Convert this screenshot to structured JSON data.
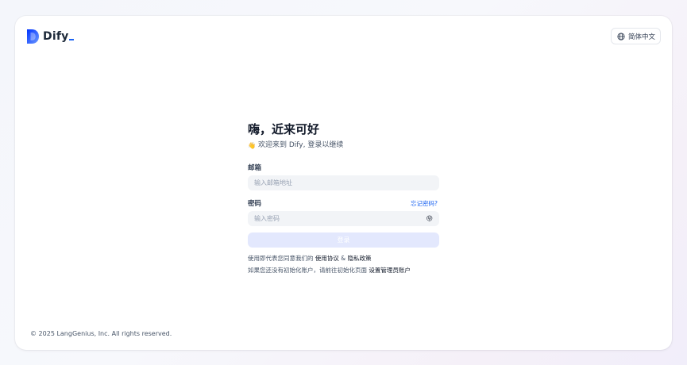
{
  "brand": {
    "name": "Dify"
  },
  "header": {
    "language_label": "简体中文"
  },
  "login": {
    "title": "嗨，近来可好",
    "subtitle_emoji": "👋",
    "subtitle": "欢迎来到 Dify, 登录以继续",
    "email": {
      "label": "邮箱",
      "placeholder": "输入邮箱地址",
      "value": ""
    },
    "password": {
      "label": "密码",
      "placeholder": "输入密码",
      "value": "",
      "forgot_label": "忘记密码?",
      "toggle_emoji": "😝"
    },
    "submit_label": "登录",
    "terms": {
      "prefix": "使用即代表您同意我们的",
      "terms_link": "使用协议",
      "and": "&",
      "privacy_link": "隐私政策"
    },
    "setup": {
      "prefix": "如果您还没有初始化账户，请前往初始化页面",
      "link": "设置管理员账户"
    }
  },
  "footer": {
    "copyright": "© 2025 LangGenius, Inc. All rights reserved."
  },
  "colors": {
    "accent": "#1c64f2",
    "button_disabled": "#e3e8fd",
    "input_bg": "#f2f4f7"
  }
}
